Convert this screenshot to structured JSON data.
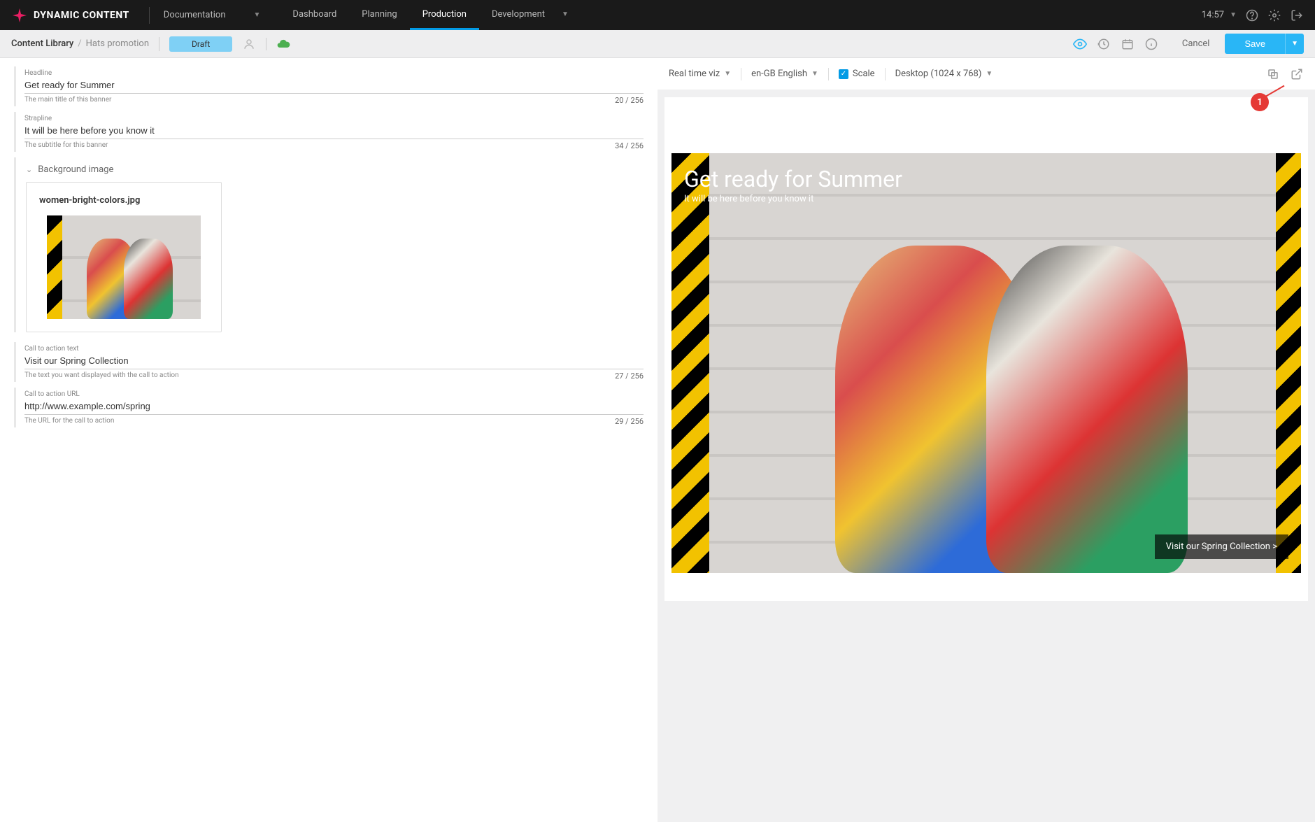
{
  "header": {
    "brand": "DYNAMIC CONTENT",
    "doc_dropdown": "Documentation",
    "tabs": [
      "Dashboard",
      "Planning",
      "Production",
      "Development"
    ],
    "active_tab": "Production",
    "time": "14:57"
  },
  "subheader": {
    "breadcrumb_root": "Content Library",
    "breadcrumb_leaf": "Hats promotion",
    "status_chip": "Draft",
    "cancel": "Cancel",
    "save": "Save"
  },
  "form": {
    "headline": {
      "label": "Headline",
      "value": "Get ready for Summer",
      "hint": "The main title of this banner",
      "counter": "20 / 256"
    },
    "strapline": {
      "label": "Strapline",
      "value": "It will be here before you know it",
      "hint": "The subtitle for this banner",
      "counter": "34 / 256"
    },
    "bg_image": {
      "section_label": "Background image",
      "filename": "women-bright-colors.jpg"
    },
    "cta_text": {
      "label": "Call to action text",
      "value": "Visit our Spring Collection",
      "hint": "The text you want displayed with the call to action",
      "counter": "27 / 256"
    },
    "cta_url": {
      "label": "Call to action URL",
      "value": "http://www.example.com/spring",
      "hint": "The URL for the call to action",
      "counter": "29 / 256"
    }
  },
  "preview_toolbar": {
    "viz": "Real time viz",
    "locale": "en-GB English",
    "scale_label": "Scale",
    "device": "Desktop (1024 x 768)"
  },
  "preview": {
    "headline": "Get ready for Summer",
    "strapline": "It will be here before you know it",
    "cta": "Visit our Spring Collection >"
  },
  "callout": {
    "num": "1"
  }
}
